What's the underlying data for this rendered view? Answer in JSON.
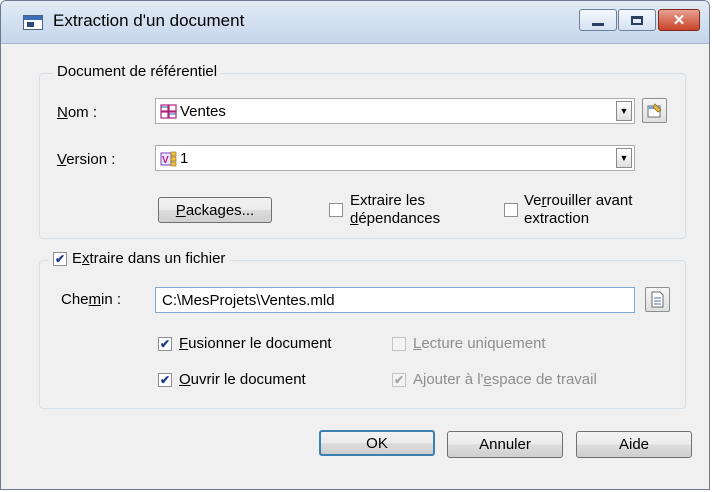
{
  "window": {
    "title": "Extraction d'un document"
  },
  "group_repo": {
    "legend": "Document de référentiel",
    "name_label": "Nom :",
    "name_value": "Ventes",
    "version_label": "Version :",
    "version_value": "1",
    "packages_button": "Packages...",
    "extract_deps_line1": "Extraire les",
    "extract_deps_line2": "dépendances",
    "extract_deps_checked": false,
    "lock_line1": "Verrouiller avant",
    "lock_line2": "extraction",
    "lock_checked": false
  },
  "group_file": {
    "legend": "Extraire dans un fichier",
    "legend_checked": true,
    "path_label": "Chemin :",
    "path_value": "C:\\MesProjets\\Ventes.mld",
    "merge_label": "Fusionner le document",
    "merge_checked": true,
    "readonly_label": "Lecture uniquement",
    "readonly_checked": false,
    "open_label": "Ouvrir le document",
    "open_checked": true,
    "workspace_label": "Ajouter à l'espace de travail",
    "workspace_checked": true
  },
  "buttons": {
    "ok": "OK",
    "cancel": "Annuler",
    "help": "Aide"
  },
  "icons": {
    "title": "window-icon",
    "name_field": "model-icon",
    "version_field": "version-icon",
    "properties": "properties-icon",
    "browse": "browse-file-icon"
  }
}
